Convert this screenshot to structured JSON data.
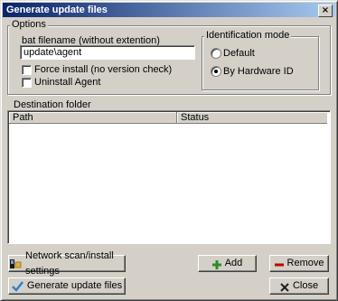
{
  "window": {
    "title": "Generate update files",
    "close_glyph": "×"
  },
  "options": {
    "group_label": "Options",
    "filename_label": "bat filename (without extention)",
    "filename_value": "update\\agent",
    "force_install_label": "Force install (no version check)",
    "force_install_checked": false,
    "uninstall_label": "Uninstall Agent",
    "uninstall_checked": false
  },
  "identification": {
    "group_label": "Identification mode",
    "default_label": "Default",
    "hardware_label": "By Hardware ID",
    "selected": "By Hardware ID"
  },
  "destination": {
    "group_label": "Destination folder",
    "columns": [
      "Path",
      "Status"
    ],
    "rows": []
  },
  "buttons": {
    "network_scan": "Network scan/install settings",
    "generate": "Generate update files",
    "add": "Add",
    "remove": "Remove",
    "close": "Close"
  },
  "icons": {
    "network_scan": "network-install-icon",
    "generate": "checkmark-icon",
    "add": "plus-icon",
    "remove": "minus-icon",
    "close": "x-icon"
  },
  "colors": {
    "titlebar_start": "#0a246a",
    "titlebar_end": "#a6caf0",
    "face": "#d4d0c8",
    "add_green": "#2e8b2e",
    "remove_red": "#c00000"
  }
}
